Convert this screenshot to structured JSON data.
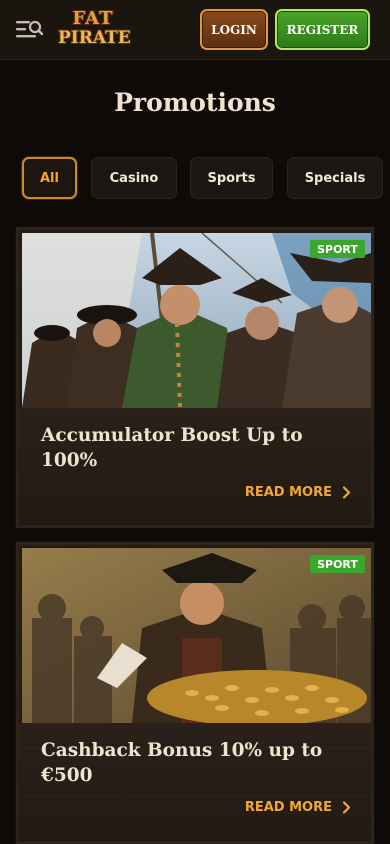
{
  "header": {
    "menu_icon": "menu-search-icon",
    "logo_top": "FAT",
    "logo_bottom": "PIRATE",
    "login_label": "LOGIN",
    "register_label": "REGISTER"
  },
  "page": {
    "title": "Promotions"
  },
  "tabs": [
    {
      "label": "All",
      "active": true
    },
    {
      "label": "Casino",
      "active": false
    },
    {
      "label": "Sports",
      "active": false
    },
    {
      "label": "Specials",
      "active": false
    }
  ],
  "promotions": [
    {
      "badge": "SPORT",
      "title": "Accumulator Boost Up to 100%",
      "cta": "READ MORE",
      "image": "pirate-crew-on-ship-illustration"
    },
    {
      "badge": "SPORT",
      "title": "Cashback Bonus 10% up to €500",
      "cta": "READ MORE",
      "image": "pirate-with-gold-coins-illustration"
    }
  ],
  "colors": {
    "accent": "#f0a734",
    "register_green": "#3aa62a",
    "login_brown": "#7a4118",
    "background": "#0d0a08",
    "header": "#1b1510"
  }
}
